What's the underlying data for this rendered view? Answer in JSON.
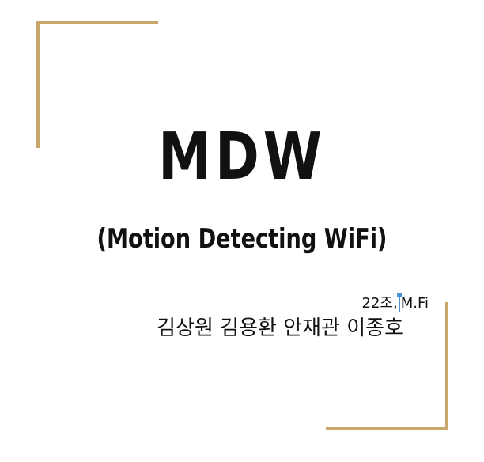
{
  "slide": {
    "title": "MDW",
    "subtitle": "(Motion Detecting WiFi)",
    "team_prefix": "22조,",
    "team_suffix": "M.Fi",
    "members": "김상원 김용환 안재관 이종호"
  },
  "colors": {
    "accent_bracket": "#c9a66b",
    "text": "#111111",
    "cursor": "#4a90d9"
  }
}
